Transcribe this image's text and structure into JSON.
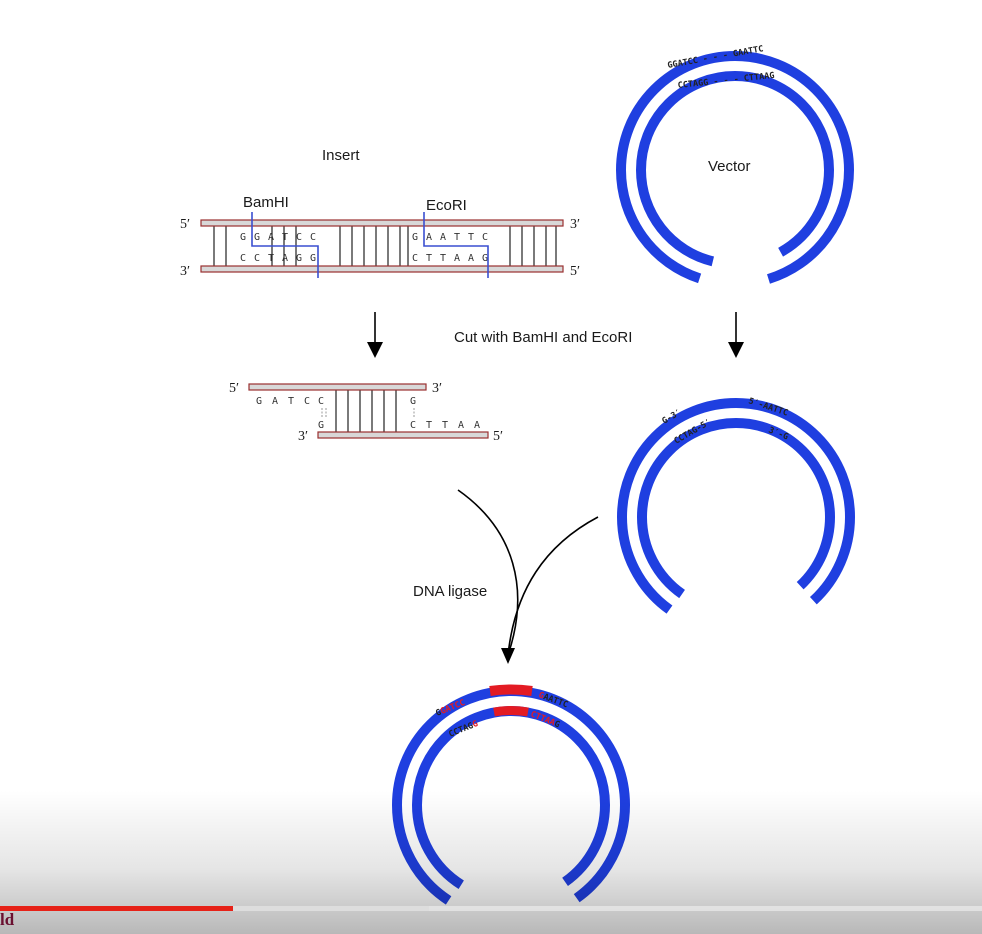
{
  "insert_label": "Insert",
  "vector_label": "Vector",
  "enzymes": {
    "bamhi": "BamHI",
    "ecori": "EcoRI"
  },
  "ends": {
    "five": "5′",
    "three": "3′"
  },
  "insert_bases": {
    "top_left": [
      "G",
      "G",
      "A",
      "T",
      "C",
      "C"
    ],
    "bottom_left": [
      "C",
      "C",
      "T",
      "A",
      "G",
      "G"
    ],
    "top_right": [
      "G",
      "A",
      "A",
      "T",
      "T",
      "C"
    ],
    "bottom_right": [
      "C",
      "T",
      "T",
      "A",
      "A",
      "G"
    ]
  },
  "vector_seq": {
    "outer": "GGATCC - - - GAATTC",
    "inner": "CCTAGG - - - CTTAAG"
  },
  "cut_label": "Cut with BamHI and EcoRI",
  "cut_insert_bases": {
    "top": [
      "G",
      "A",
      "T",
      "C",
      "C"
    ],
    "left_bottom": "G",
    "right_top": "G",
    "bottom": [
      "C",
      "T",
      "T",
      "A",
      "A"
    ]
  },
  "cut_vector_seq": {
    "left_outer": "G-3′",
    "left_inner": "CCTAG-5′",
    "right_outer": "5′-AATTC",
    "right_inner": "3′-G"
  },
  "ligase_label": "DNA ligase",
  "product_seq": {
    "outer_left_black": "G",
    "outer_left_red": "GATCC",
    "outer_right_red": "G",
    "outer_right_black": "AATTC",
    "inner_left_black": "CCTAG",
    "inner_left_red": "G",
    "inner_right_red": "CTTAA",
    "inner_right_black": "G"
  },
  "colors": {
    "vector": "#1f3fe0",
    "insert_strand": "#c0c0c0",
    "strand_outline": "#9a3030",
    "insert_red": "#e31b23",
    "cut_line": "#3a4fd0"
  },
  "player": {
    "played_fraction": 0.237,
    "buffered_fraction": 0.437,
    "corner_text": "ld"
  }
}
